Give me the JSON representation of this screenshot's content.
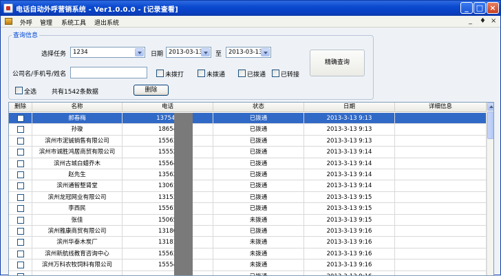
{
  "window": {
    "title": "电话自动外呼营销系统 - Ver1.0.0.0 - [记录查看]",
    "min_glyph": "_",
    "max_glyph": "□",
    "close_glyph": "×"
  },
  "menubar": {
    "items": [
      "外呼",
      "管理",
      "系统工具",
      "退出系统"
    ],
    "mdi_controls": [
      "_",
      "♦",
      "×"
    ]
  },
  "filter": {
    "group_title": "查询信息",
    "task_label": "选择任务",
    "task_value": "1234",
    "date_label": "日期",
    "date_from": "2013-03-13",
    "to_label": "至",
    "date_to": "2013-03-13",
    "search_label": "公司名/手机号/姓名",
    "search_value": "",
    "checkboxes": [
      "未拨打",
      "未拨通",
      "已拨通",
      "已转接"
    ],
    "select_all_label": "全选",
    "count_text": "共有1542条数据",
    "delete_button": "删除",
    "query_button": "精确查询"
  },
  "table": {
    "columns": [
      "删除",
      "名称",
      "电话",
      "状态",
      "日期",
      "详细信息"
    ],
    "rows": [
      {
        "name": "郝春梅",
        "phone": "137546",
        "status": "已拨通",
        "date": "2013-3-13 9:13",
        "selected": true
      },
      {
        "name": "孙璇",
        "phone": "18654",
        "status": "已拨通",
        "date": "2013-3-13 9:13"
      },
      {
        "name": "滨州市泥铖销售有限公司",
        "phone": "15563",
        "status": "已拨通",
        "date": "2013-3-13 9:13"
      },
      {
        "name": "滨州市诚胜鸿居商贸有限公司",
        "phone": "15552",
        "status": "已拨通",
        "date": "2013-3-13 9:14"
      },
      {
        "name": "滨州古城白蜡乔木",
        "phone": "15564",
        "status": "已拨通",
        "date": "2013-3-13 9:14"
      },
      {
        "name": "赵先生",
        "phone": "13562",
        "status": "已拨通",
        "date": "2013-3-13 9:14"
      },
      {
        "name": "滨州通智整肾堂",
        "phone": "13061",
        "status": "已拨通",
        "date": "2013-3-13 9:14"
      },
      {
        "name": "滨州龙冠网业有限公司",
        "phone": "13153",
        "status": "已拨通",
        "date": "2013-3-13 9:15"
      },
      {
        "name": "李西民",
        "phone": "15561",
        "status": "已拨通",
        "date": "2013-3-13 9:15"
      },
      {
        "name": "张佳",
        "phone": "15065",
        "status": "未拨通",
        "date": "2013-3-13 9:15"
      },
      {
        "name": "滨州雅康商贸有限公司",
        "phone": "13186",
        "status": "已拨通",
        "date": "2013-3-13 9:16"
      },
      {
        "name": "滨州华泰木炭厂",
        "phone": "13181",
        "status": "未拨通",
        "date": "2013-3-13 9:16"
      },
      {
        "name": "滨州新航线教育咨询中心",
        "phone": "15563",
        "status": "未拨通",
        "date": "2013-3-13 9:16"
      },
      {
        "name": "滨州万科农牧饲料有限公司",
        "phone": "15554",
        "status": "未拨通",
        "date": "2013-3-13 9:16"
      },
      {
        "name": "",
        "phone": "",
        "status": "已拨通",
        "date": "2013-3-13 9:16"
      }
    ]
  },
  "colors": {
    "titlebar": "#0a4ad0",
    "selection": "#3169c6",
    "group_title": "#0046d5",
    "redaction": "#7a7a7a"
  }
}
